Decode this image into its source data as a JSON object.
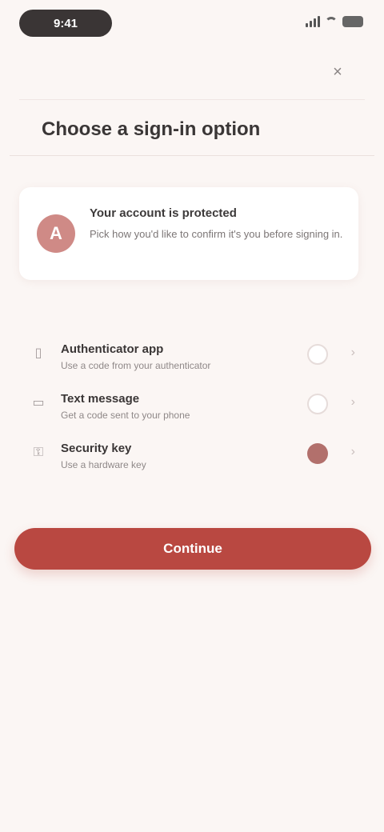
{
  "status_bar": {
    "time": "9:41"
  },
  "header": {
    "close_label": "×",
    "title": "Choose a sign-in option"
  },
  "info_card": {
    "avatar_initial": "A",
    "title": "Your account is protected",
    "description": "Pick how you'd like to confirm it's you before signing in."
  },
  "options": [
    {
      "title": "Authenticator app",
      "subtitle": "Use a code from your authenticator",
      "selected": false
    },
    {
      "title": "Text message",
      "subtitle": "Get a code sent to your phone",
      "selected": false
    },
    {
      "title": "Security key",
      "subtitle": "Use a hardware key",
      "selected": true
    }
  ],
  "cta": {
    "label": "Continue"
  },
  "colors": {
    "accent": "#b94841",
    "selected_radio": "#b2706c",
    "avatar": "#cf8a86",
    "background": "#fbf6f4"
  },
  "icons": {
    "close": "close-icon",
    "option_1": "phone-icon",
    "option_2": "message-icon",
    "option_3": "key-icon"
  }
}
